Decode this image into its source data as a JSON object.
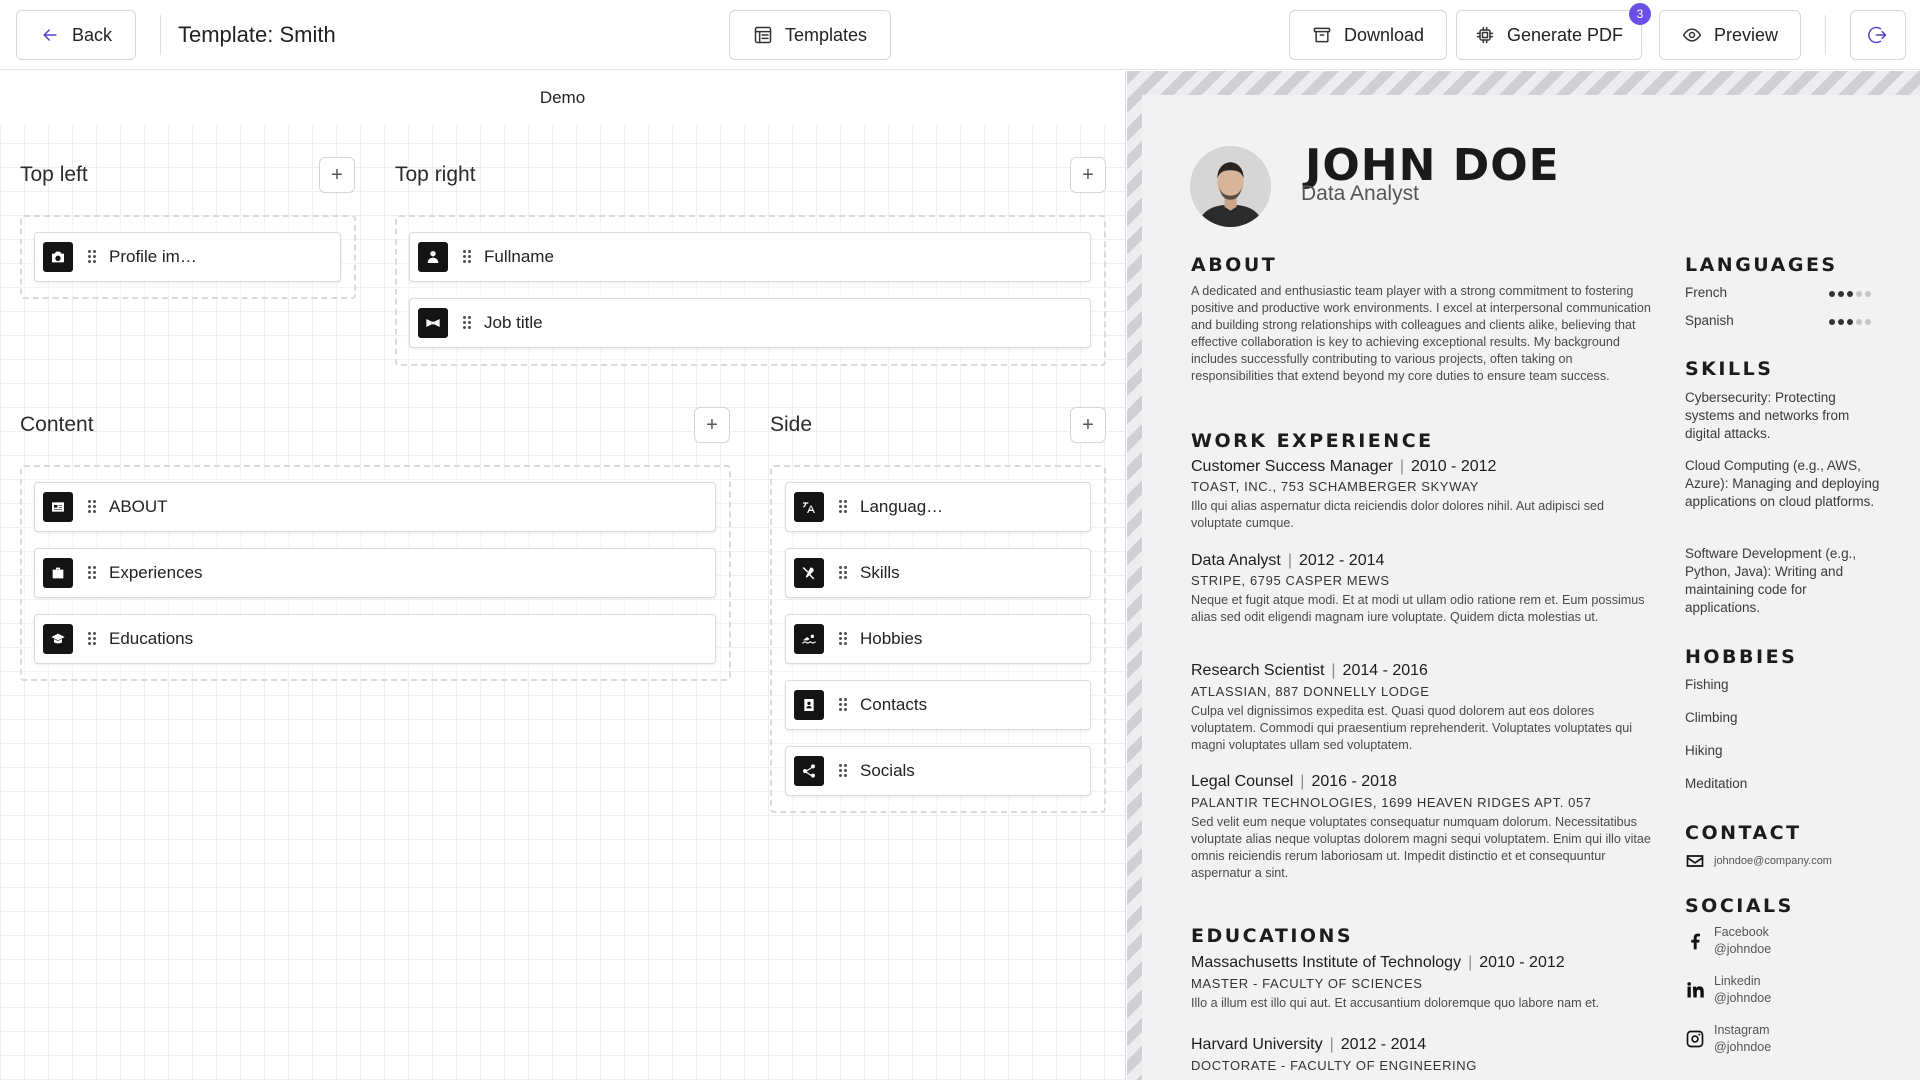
{
  "topbar": {
    "back_label": "Back",
    "page_title": "Template: Smith",
    "templates_label": "Templates",
    "download_label": "Download",
    "generate_pdf_label": "Generate PDF",
    "generate_pdf_badge": "3",
    "preview_label": "Preview",
    "accent": "#6b4ee6"
  },
  "editor": {
    "demo_label": "Demo",
    "add_symbol": "+",
    "sections": {
      "top_left": {
        "title": "Top left",
        "blocks": [
          {
            "label": "Profile im…",
            "icon": "camera-icon"
          }
        ]
      },
      "top_right": {
        "title": "Top right",
        "blocks": [
          {
            "label": "Fullname",
            "icon": "user-icon"
          },
          {
            "label": "Job title",
            "icon": "bowtie-icon"
          }
        ]
      },
      "content": {
        "title": "Content",
        "blocks": [
          {
            "label": "ABOUT",
            "icon": "id-card-icon"
          },
          {
            "label": "Experiences",
            "icon": "briefcase-icon"
          },
          {
            "label": "Educations",
            "icon": "graduation-cap-icon"
          }
        ]
      },
      "side": {
        "title": "Side",
        "blocks": [
          {
            "label": "Languag…",
            "icon": "translate-icon"
          },
          {
            "label": "Skills",
            "icon": "tools-icon"
          },
          {
            "label": "Hobbies",
            "icon": "swimmer-icon"
          },
          {
            "label": "Contacts",
            "icon": "address-book-icon"
          },
          {
            "label": "Socials",
            "icon": "share-icon"
          }
        ]
      }
    }
  },
  "resume": {
    "name": "JOHN DOE",
    "job_title": "Data Analyst",
    "about": {
      "heading": "ABOUT",
      "text": "A dedicated and enthusiastic team player with a strong commitment to fostering positive and productive work environments. I excel at interpersonal communication and building strong relationships with colleagues and clients alike, believing that effective collaboration is key to achieving exceptional results. My background includes successfully contributing to various projects, often taking on responsibilities that extend beyond my core duties to ensure team success."
    },
    "experience": {
      "heading": "WORK EXPERIENCE",
      "items": [
        {
          "role": "Customer Success Manager",
          "dates": "2010 - 2012",
          "company": "TOAST, INC., 753 SCHAMBERGER SKYWAY",
          "desc": "Illo qui alias aspernatur dicta reiciendis dolor dolores nihil. Aut adipisci sed voluptate cumque."
        },
        {
          "role": "Data Analyst",
          "dates": "2012 - 2014",
          "company": "STRIPE, 6795 CASPER MEWS",
          "desc": "Neque et fugit atque modi. Et at modi ut ullam odio ratione rem et. Eum possimus alias sed odit eligendi magnam iure voluptate. Quidem dicta molestias ut."
        },
        {
          "role": "Research Scientist",
          "dates": "2014 - 2016",
          "company": "ATLASSIAN, 887 DONNELLY LODGE",
          "desc": "Culpa vel dignissimos expedita est. Quasi quod dolorem aut eos dolores voluptatem. Commodi qui praesentium reprehenderit. Voluptates voluptates qui magni voluptates ullam sed voluptatem."
        },
        {
          "role": "Legal Counsel",
          "dates": "2016 - 2018",
          "company": "PALANTIR TECHNOLOGIES, 1699 HEAVEN RIDGES APT. 057",
          "desc": "Sed velit eum neque voluptates consequatur numquam dolorum. Necessitatibus voluptate alias neque voluptas dolorem magni sequi voluptatem. Enim qui illo vitae omnis reiciendis rerum laboriosam ut. Impedit distinctio et et consequuntur aspernatur a sint."
        }
      ]
    },
    "education": {
      "heading": "EDUCATIONS",
      "items": [
        {
          "school": "Massachusetts Institute of Technology",
          "dates": "2010 - 2012",
          "degree": "MASTER - FACULTY OF SCIENCES",
          "desc": "Illo a illum est illo qui aut. Et accusantium doloremque quo labore nam et."
        },
        {
          "school": "Harvard University",
          "dates": "2012 - 2014",
          "degree": "DOCTORATE - FACULTY OF ENGINEERING"
        }
      ]
    },
    "languages": {
      "heading": "LANGUAGES",
      "items": [
        {
          "name": "French",
          "level": 3,
          "max": 5
        },
        {
          "name": "Spanish",
          "level": 3,
          "max": 5
        }
      ]
    },
    "skills": {
      "heading": "SKILLS",
      "items": [
        "Cybersecurity: Protecting systems and networks from digital attacks.",
        "Cloud Computing (e.g., AWS, Azure): Managing and deploying applications on cloud platforms.",
        "Software Development (e.g., Python, Java): Writing and maintaining code for applications."
      ]
    },
    "hobbies": {
      "heading": "HOBBIES",
      "items": [
        "Fishing",
        "Climbing",
        "Hiking",
        "Meditation"
      ]
    },
    "contact": {
      "heading": "CONTACT",
      "email": "johndoe@company.com"
    },
    "socials": {
      "heading": "SOCIALS",
      "items": [
        {
          "network": "Facebook",
          "handle": "@johndoe"
        },
        {
          "network": "Linkedin",
          "handle": "@johndoe"
        },
        {
          "network": "Instagram",
          "handle": "@johndoe"
        }
      ]
    }
  }
}
